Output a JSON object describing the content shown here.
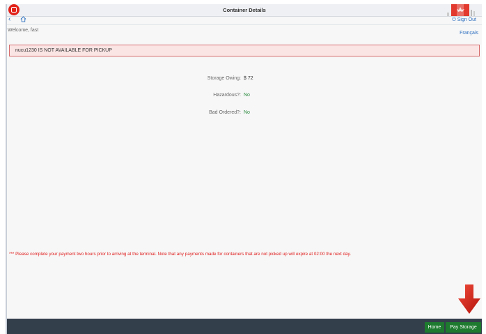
{
  "header": {
    "title": "Container Details",
    "sign_out_label": "Sign Out",
    "brand_color": "#e2231a"
  },
  "user": {
    "welcome": "Welcome, fast",
    "language_link": "Français"
  },
  "alert": {
    "message": "nucu1230 IS NOT AVAILABLE FOR PICKUP"
  },
  "details": {
    "storage_owing_label": "Storage Owing:",
    "storage_owing_value": "$ 72",
    "hazardous_label": "Hazardous?:",
    "hazardous_value": "No",
    "bad_ordered_label": "Bad Ordered?:",
    "bad_ordered_value": "No"
  },
  "note": {
    "text": "*** Please complete your payment two hours prior to arriving at the terminal. Note that any payments made for containers that are not picked up will expire at 02:00 the next day."
  },
  "footer": {
    "home_label": "Home",
    "pay_storage_label": "Pay Storage",
    "button_color": "#1d7a2e"
  },
  "icons": {
    "back": "chevron-left-icon",
    "home": "home-icon",
    "sign_out": "power-icon",
    "scroll_down": "red-down-arrow-icon"
  }
}
